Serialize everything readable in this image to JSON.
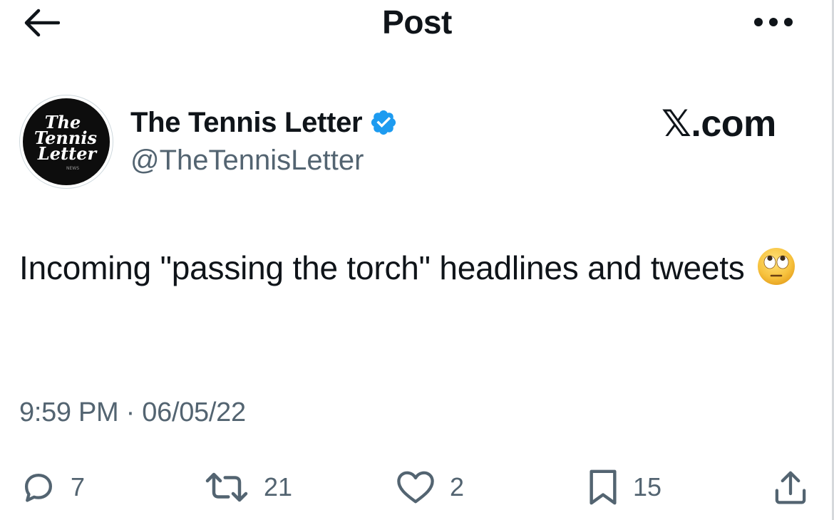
{
  "header": {
    "title": "Post"
  },
  "author": {
    "name": "The Tennis Letter",
    "handle": "@TheTennisLetter",
    "avatar_text": [
      "The",
      "Tennis",
      "Letter",
      "NEWS"
    ],
    "verified": true
  },
  "source": "𝕏.com",
  "tweet": {
    "text": "Incoming \"passing the torch\" headlines and tweets",
    "emoji": "face-with-rolling-eyes",
    "timestamp": "9:59 PM · 06/05/22"
  },
  "actions": {
    "replies": "7",
    "reposts": "21",
    "likes": "2",
    "bookmarks": "15"
  },
  "colors": {
    "text": "#0f1419",
    "secondary": "#536471",
    "verified_blue": "#1d9bf0"
  },
  "icons": [
    "back-arrow-icon",
    "more-dots-icon",
    "verified-badge-icon",
    "reply-icon",
    "repost-icon",
    "like-icon",
    "bookmark-icon",
    "share-icon"
  ]
}
